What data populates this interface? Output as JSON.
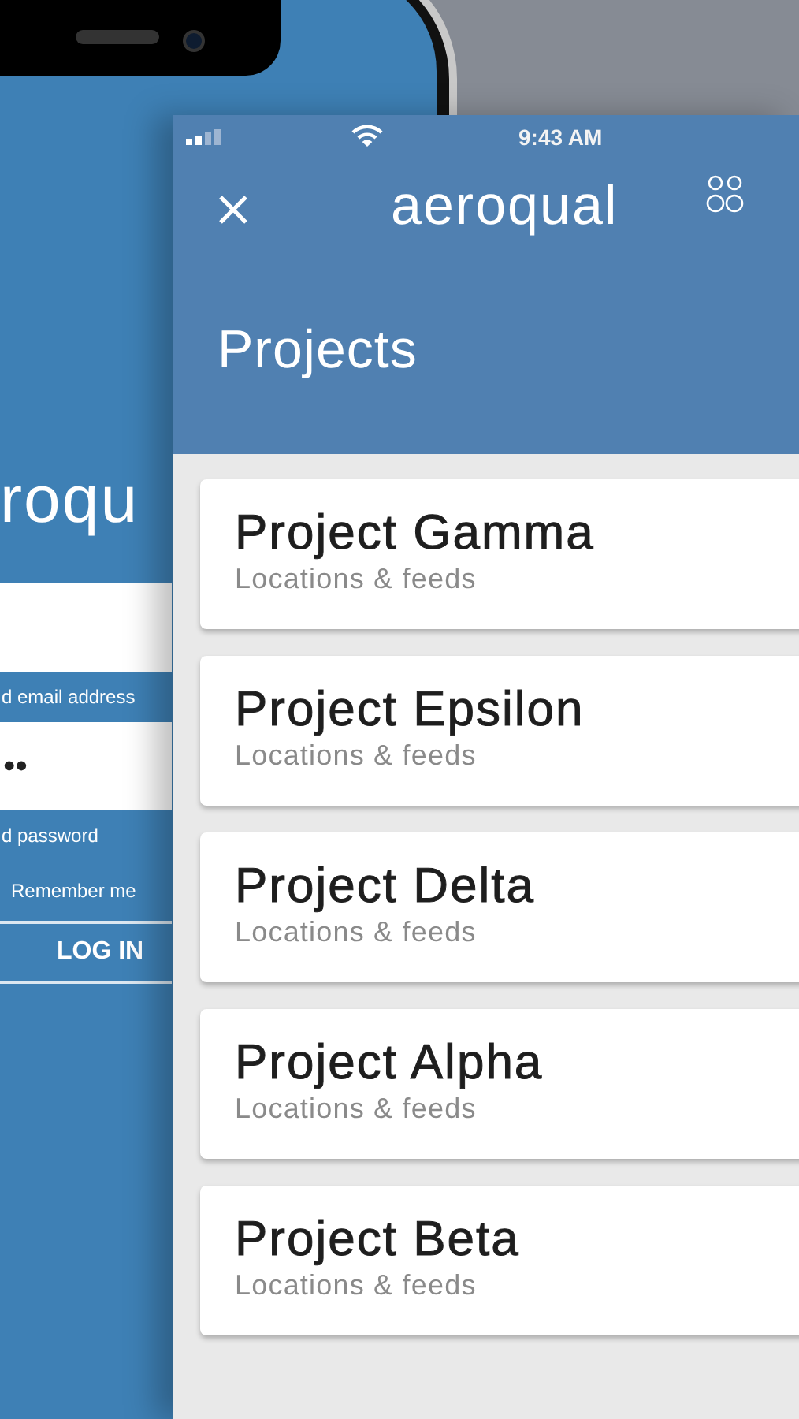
{
  "back_screen": {
    "logo": "roqu",
    "items": [
      {
        "kind": "field"
      },
      {
        "kind": "label",
        "text": "d email address"
      },
      {
        "kind": "field",
        "value": "••"
      },
      {
        "kind": "label",
        "text": "d password"
      },
      {
        "kind": "check",
        "text": "Remember me"
      },
      {
        "kind": "button",
        "text": "LOG IN"
      }
    ]
  },
  "status_bar": {
    "time": "9:43 AM"
  },
  "header": {
    "logo": "aeroqual",
    "title": "Projects"
  },
  "projects": [
    {
      "name": "Project Gamma",
      "subtitle": "Locations & feeds"
    },
    {
      "name": "Project Epsilon",
      "subtitle": "Locations & feeds"
    },
    {
      "name": "Project Delta",
      "subtitle": "Locations & feeds"
    },
    {
      "name": "Project Alpha",
      "subtitle": "Locations & feeds"
    },
    {
      "name": "Project Beta",
      "subtitle": "Locations & feeds"
    }
  ]
}
